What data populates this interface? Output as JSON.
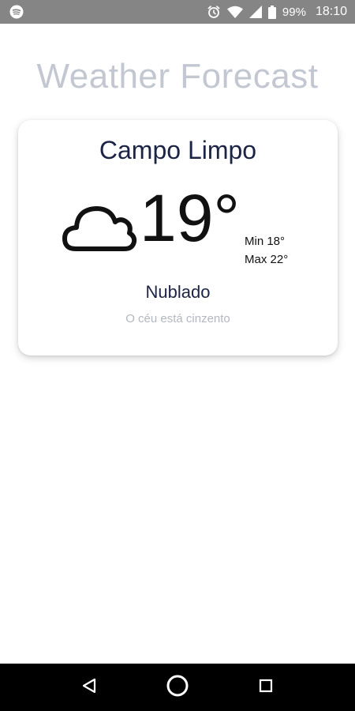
{
  "status_bar": {
    "app_icon": "spotify-icon",
    "alarm_icon": "alarm-icon",
    "wifi_icon": "wifi-icon",
    "signal_icon": "signal-icon",
    "battery_icon": "battery-icon",
    "battery": "99%",
    "time": "18:10",
    "background_color": "#858585"
  },
  "header": {
    "title": "Weather Forecast",
    "title_color": "#c2c7d2"
  },
  "weather_card": {
    "city": "Campo Limpo",
    "icon": "cloud-icon",
    "temperature": "19°",
    "min": "Min 18°",
    "max": "Max 22°",
    "condition": "Nublado",
    "description": "O céu está cinzento",
    "text_color": "#1c2445"
  },
  "nav_bar": {
    "back_icon": "back-triangle-icon",
    "home_icon": "home-circle-icon",
    "recents_icon": "recents-square-icon"
  }
}
